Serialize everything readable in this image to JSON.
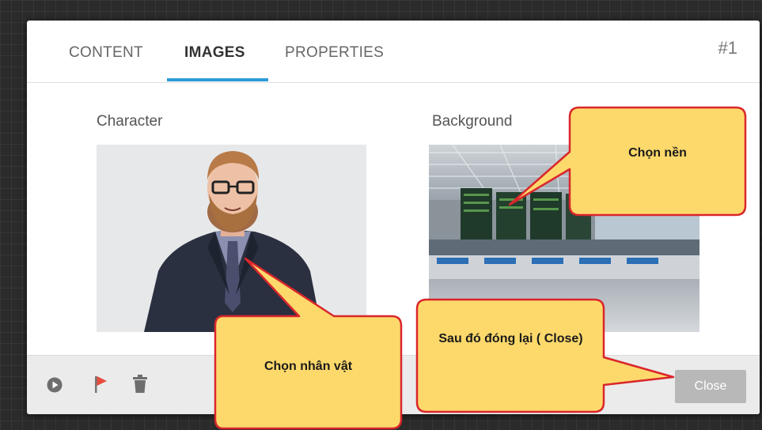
{
  "tabs": [
    {
      "label": "CONTENT",
      "active": false
    },
    {
      "label": "IMAGES",
      "active": true
    },
    {
      "label": "PROPERTIES",
      "active": false
    }
  ],
  "slide_number": "#1",
  "character": {
    "label": "Character"
  },
  "background": {
    "label": "Background"
  },
  "footer": {
    "icons": [
      "play-icon",
      "flag-icon",
      "trash-icon"
    ],
    "close_label": "Close"
  },
  "callouts": {
    "background": "Chọn nền",
    "character": "Chọn nhân vật",
    "close": "Sau đó đóng lại ( Close)"
  },
  "colors": {
    "accent": "#2b9ad6",
    "callout_fill": "#fdd96b",
    "callout_border": "#d9262c",
    "flag": "#e74c3c"
  }
}
